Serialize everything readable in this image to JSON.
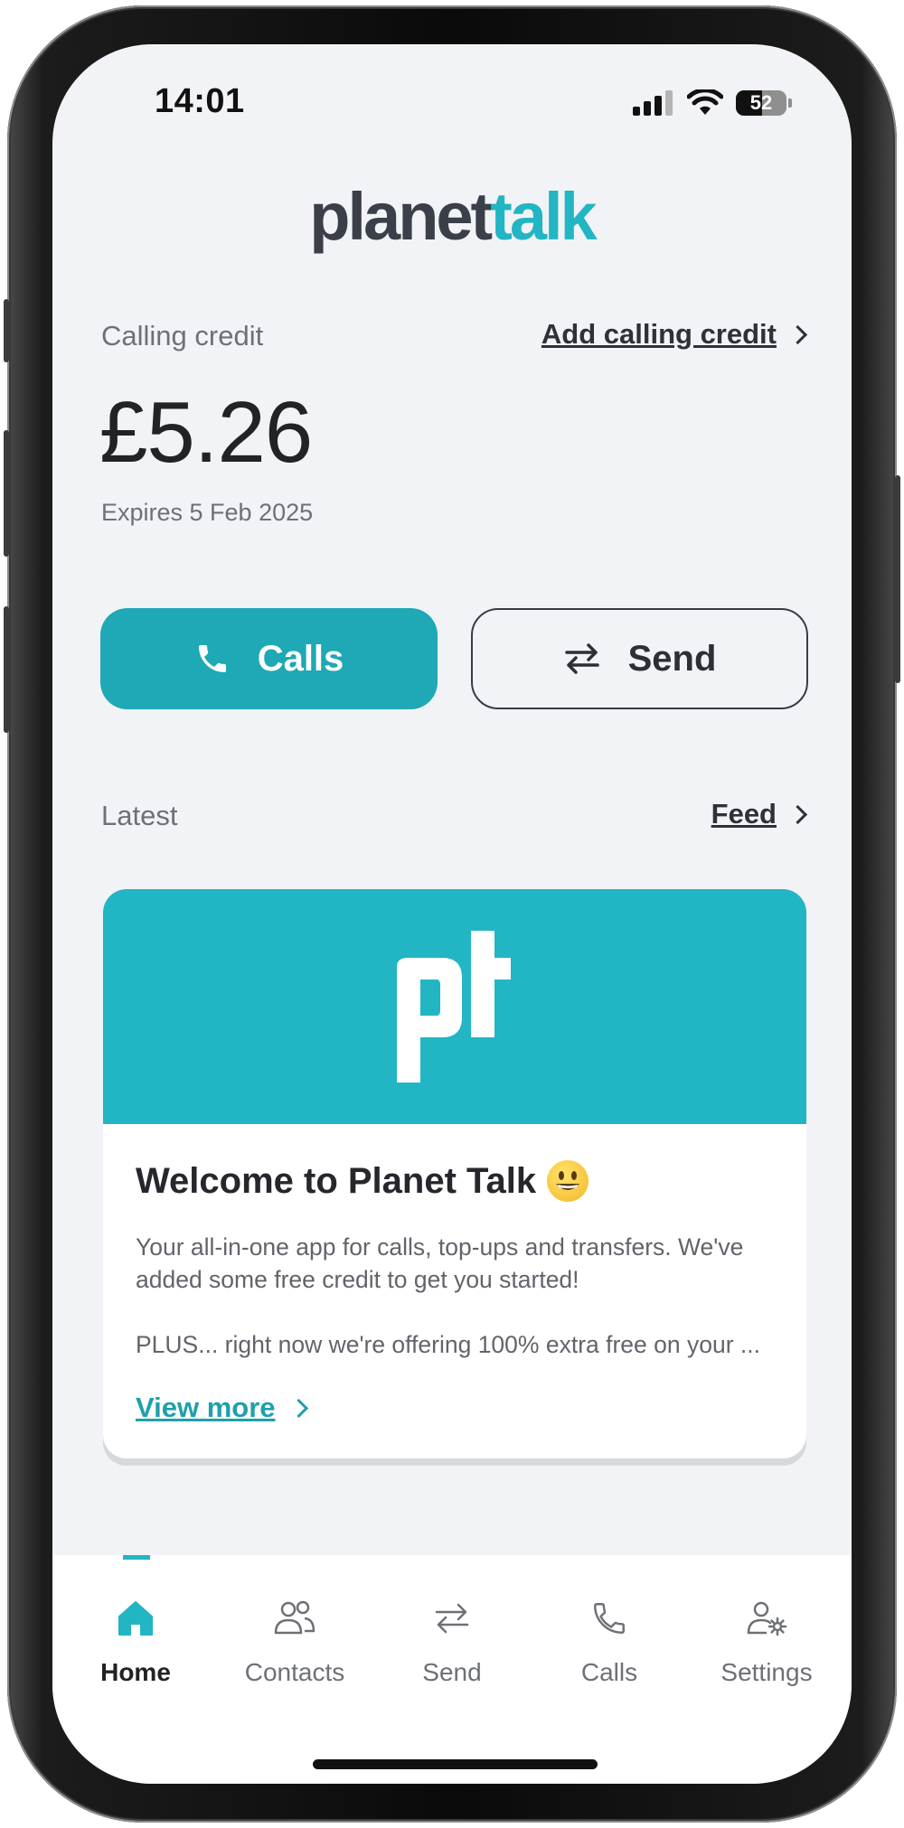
{
  "status_bar": {
    "time": "14:01",
    "battery": "52"
  },
  "logo": {
    "part1": "planet",
    "part2": "talk"
  },
  "credit": {
    "label": "Calling credit",
    "add_link": "Add calling credit",
    "amount": "£5.26",
    "expires": "Expires 5 Feb 2025"
  },
  "actions": {
    "calls": "Calls",
    "send": "Send"
  },
  "latest": {
    "label": "Latest",
    "feed_link": "Feed"
  },
  "card": {
    "title": "Welcome to Planet Talk",
    "body1": "Your all-in-one app for calls, top-ups and transfers. We've added some free credit to get you started!",
    "body2": "PLUS... right now we're offering 100% extra free on your ...",
    "view_more": "View more"
  },
  "nav": {
    "items": [
      {
        "label": "Home",
        "icon": "home-icon",
        "active": true
      },
      {
        "label": "Contacts",
        "icon": "contacts-icon"
      },
      {
        "label": "Send",
        "icon": "transfer-icon"
      },
      {
        "label": "Calls",
        "icon": "phone-icon"
      },
      {
        "label": "Settings",
        "icon": "user-settings-icon"
      }
    ]
  },
  "colors": {
    "brand": "#22b5c3",
    "button": "#1fa8b5",
    "text_dark": "#222327"
  }
}
